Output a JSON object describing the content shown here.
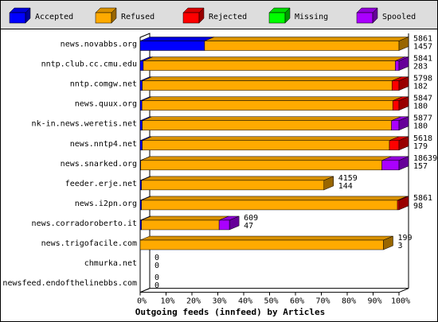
{
  "chart_data": {
    "type": "bar",
    "orientation": "horizontal",
    "stacked": true,
    "percent_scale": true,
    "title": "Outgoing feeds (innfeed) by Articles",
    "xlim": [
      0,
      100
    ],
    "x_ticks": [
      "0%",
      "10%",
      "20%",
      "30%",
      "40%",
      "50%",
      "60%",
      "70%",
      "80%",
      "90%",
      "100%"
    ],
    "legend_position": "top",
    "legend": [
      {
        "name": "Accepted",
        "color": "#0000ff"
      },
      {
        "name": "Refused",
        "color": "#ffaa00"
      },
      {
        "name": "Rejected",
        "color": "#ff0000"
      },
      {
        "name": "Missing",
        "color": "#00ff00"
      },
      {
        "name": "Spooled",
        "color": "#aa00ff"
      }
    ],
    "categories": [
      "news.novabbs.org",
      "nntp.club.cc.cmu.edu",
      "nntp.comgw.net",
      "news.quux.org",
      "nk-in.news.weretis.net",
      "news.nntp4.net",
      "news.snarked.org",
      "feeder.erje.net",
      "news.i2pn.org",
      "news.corradoroberto.it",
      "news.trigofacile.com",
      "chmurka.net",
      "newsfeed.endofthelinebbs.com"
    ],
    "offered_labels": [
      "5861",
      "5841",
      "5798",
      "5847",
      "5877",
      "5618",
      "18639",
      "4159",
      "5861",
      "609",
      "199",
      "0",
      "0"
    ],
    "accepted_labels": [
      "1457",
      "283",
      "182",
      "180",
      "180",
      "179",
      "157",
      "144",
      "98",
      "47",
      "3",
      "0",
      "0"
    ],
    "series": [
      {
        "name": "Accepted",
        "values": [
          24.9,
          1.2,
          0.8,
          0.7,
          0.8,
          0.8,
          0.2,
          0.5,
          0.5,
          0.5,
          0,
          0,
          0
        ]
      },
      {
        "name": "Refused",
        "values": [
          75.1,
          97.4,
          96.5,
          96.9,
          96.3,
          95.5,
          93.2,
          70.5,
          98.9,
          30.0,
          94.0,
          0,
          0
        ]
      },
      {
        "name": "Rejected",
        "values": [
          0,
          0,
          2.7,
          2.4,
          0,
          3.7,
          0,
          0,
          0.6,
          0,
          0,
          0,
          0
        ]
      },
      {
        "name": "Missing",
        "values": [
          0,
          0,
          0,
          0,
          0,
          0,
          0,
          0,
          0,
          0,
          0,
          0,
          0
        ]
      },
      {
        "name": "Spooled",
        "values": [
          0,
          1.4,
          0,
          0,
          2.9,
          0,
          6.6,
          0,
          0,
          4.0,
          0,
          0,
          0
        ]
      }
    ]
  }
}
